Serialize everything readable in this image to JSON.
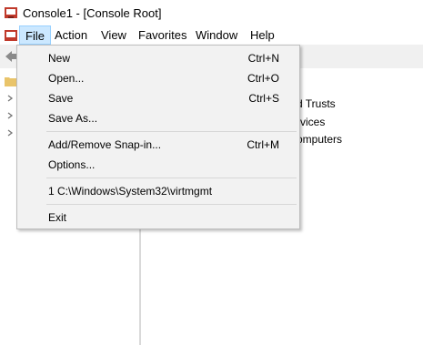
{
  "window": {
    "title": "Console1 - [Console Root]"
  },
  "menubar": {
    "items": [
      {
        "label": "File",
        "active": true
      },
      {
        "label": "Action"
      },
      {
        "label": "View"
      },
      {
        "label": "Favorites"
      },
      {
        "label": "Window"
      },
      {
        "label": "Help"
      }
    ]
  },
  "file_menu": {
    "new": {
      "label": "New",
      "shortcut": "Ctrl+N"
    },
    "open": {
      "label": "Open...",
      "shortcut": "Ctrl+O"
    },
    "save": {
      "label": "Save",
      "shortcut": "Ctrl+S"
    },
    "save_as": {
      "label": "Save As..."
    },
    "add_remove_snapin": {
      "label": "Add/Remove Snap-in...",
      "shortcut": "Ctrl+M"
    },
    "options": {
      "label": "Options..."
    },
    "recent1": {
      "label": "1 C:\\Windows\\System32\\virtmgmt"
    },
    "exit": {
      "label": "Exit"
    }
  },
  "right_pane": {
    "items": [
      "d Trusts",
      "rvices",
      "omputers"
    ]
  },
  "icons": {
    "app": "mmc-console-icon",
    "doc": "console-doc-icon",
    "back": "back-arrow-icon",
    "folder": "folder-icon",
    "chevron": "chevron-right-icon"
  }
}
